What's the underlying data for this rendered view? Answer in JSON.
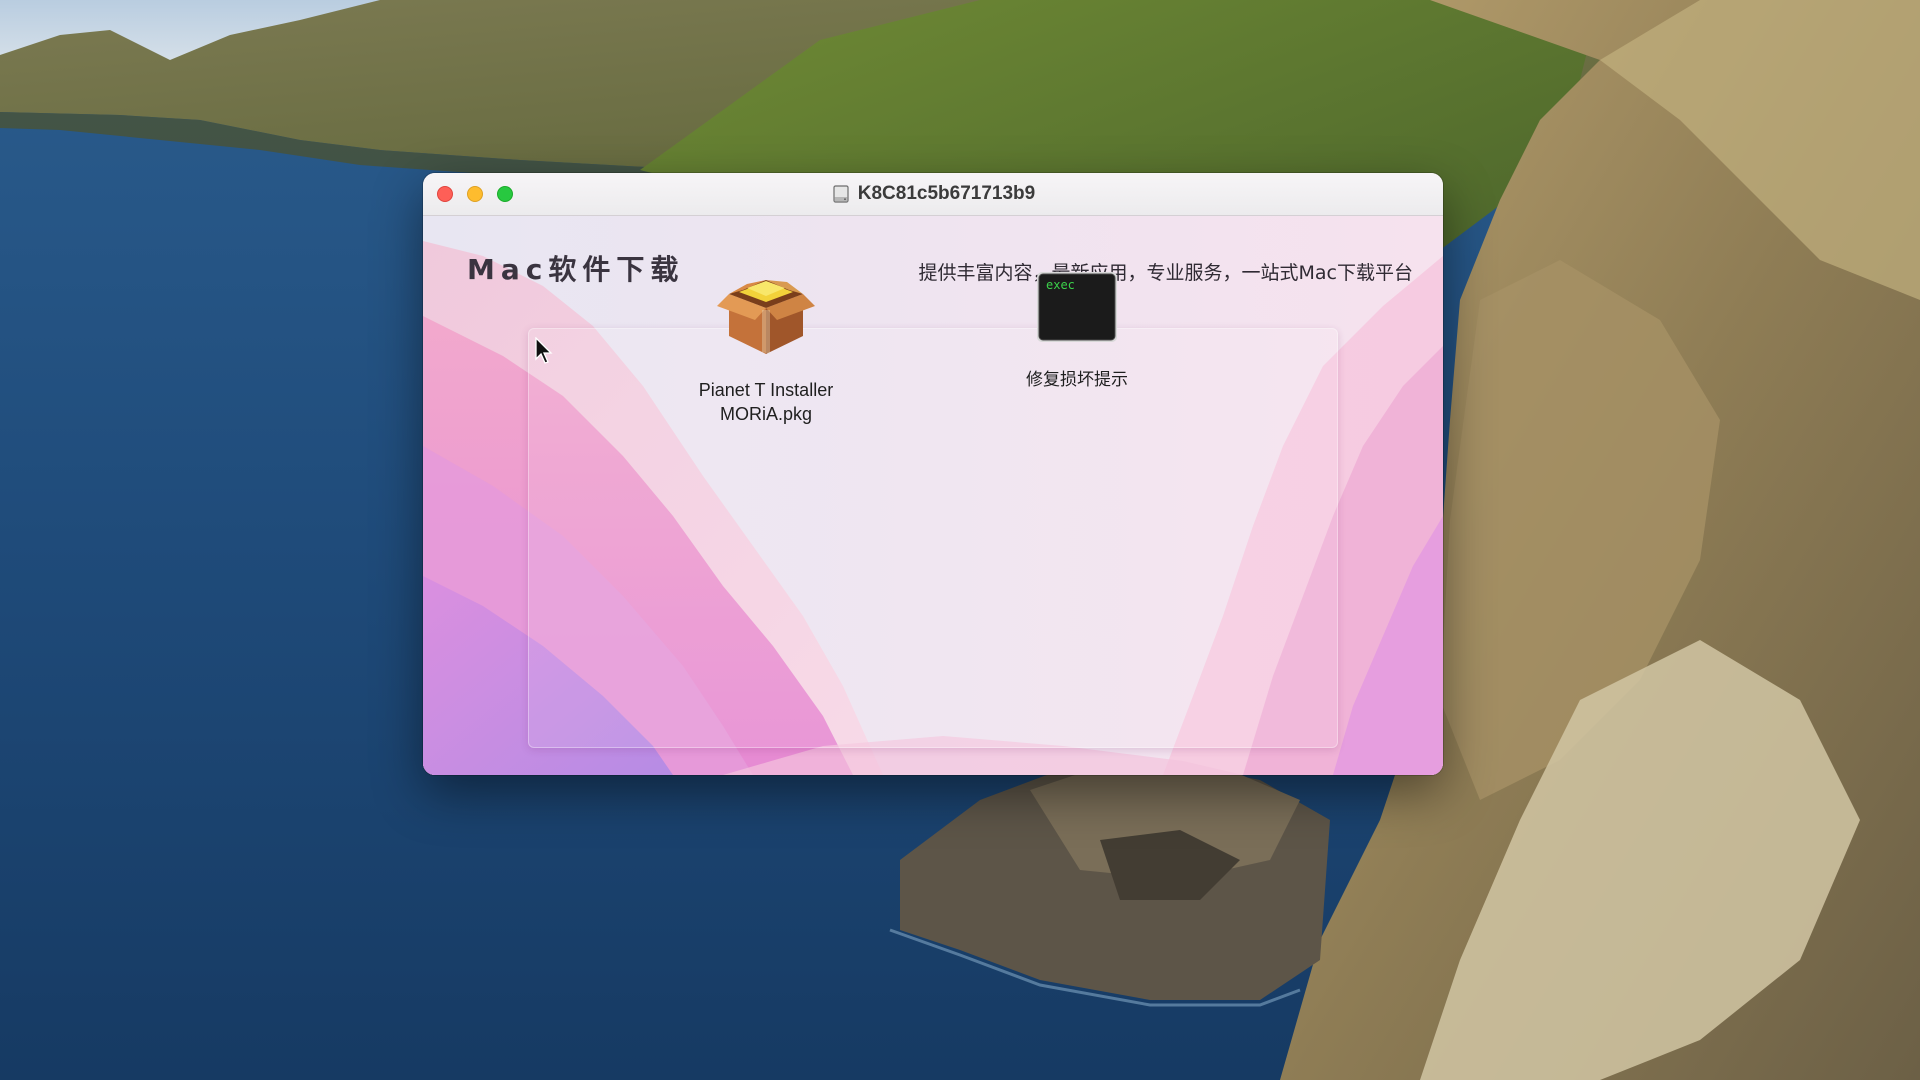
{
  "window": {
    "title": "K8C81c5b671713b9",
    "traffic_lights": [
      "close-button",
      "minimize-button",
      "zoom-button"
    ]
  },
  "header": {
    "brand": "Mac软件下载",
    "tagline": "提供丰富内容，最新应用，专业服务，一站式Mac下载平台"
  },
  "files": [
    {
      "label": "Pianet T Installer\nMORiA.pkg",
      "icon": "package-icon"
    },
    {
      "label": "修复损坏提示",
      "icon": "exec-terminal-icon",
      "icon_text": "exec"
    }
  ],
  "icons": {
    "title_icon": "disk-image-icon",
    "cursor": "arrow-cursor-icon"
  },
  "colors": {
    "close": "#fe5f57",
    "minimize": "#febc2e",
    "zoom": "#28c840",
    "exec_text": "#3bd14a"
  }
}
